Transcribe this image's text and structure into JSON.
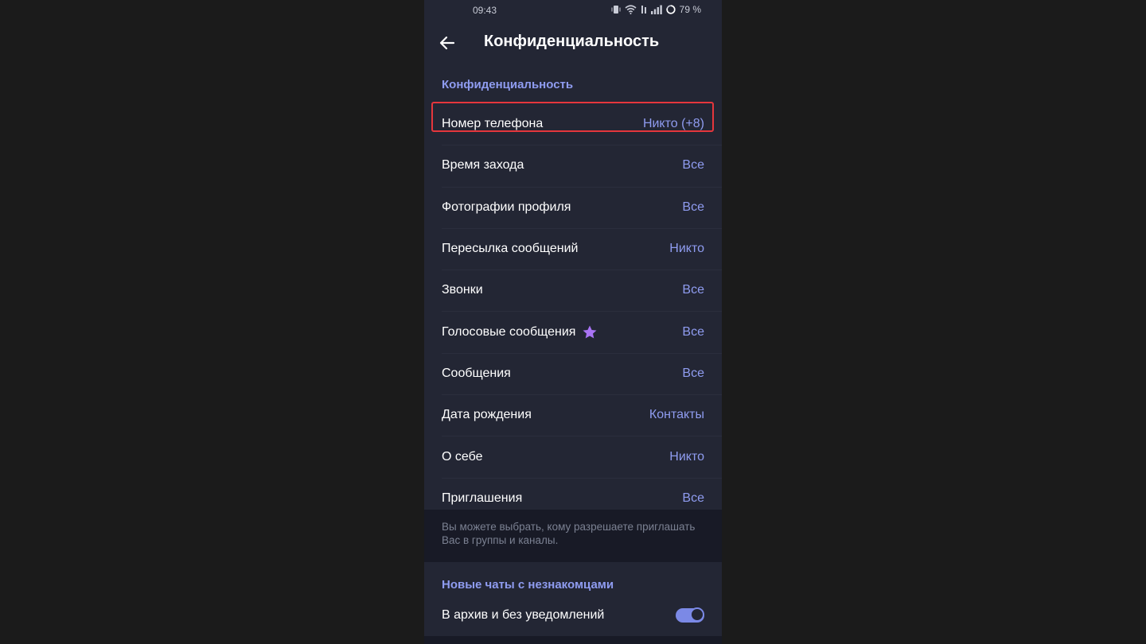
{
  "statusbar": {
    "time": "09:43",
    "battery": "79 %",
    "icons": [
      "vibrate-icon",
      "wifi-icon",
      "volte-icon",
      "signal-icon",
      "battery-icon"
    ]
  },
  "header": {
    "title": "Конфиденциальность",
    "back_icon": "arrow-left-icon"
  },
  "privacy": {
    "section_title": "Конфиденциальность",
    "items": [
      {
        "label": "Номер телефона",
        "value": "Никто (+8)"
      },
      {
        "label": "Время захода",
        "value": "Все"
      },
      {
        "label": "Фотографии профиля",
        "value": "Все"
      },
      {
        "label": "Пересылка сообщений",
        "value": "Никто"
      },
      {
        "label": "Звонки",
        "value": "Все"
      },
      {
        "label": "Голосовые сообщения",
        "value": "Все",
        "badge_icon": "premium-star-icon"
      },
      {
        "label": "Сообщения",
        "value": "Все"
      },
      {
        "label": "Дата рождения",
        "value": "Контакты"
      },
      {
        "label": "О себе",
        "value": "Никто"
      },
      {
        "label": "Приглашения",
        "value": "Все"
      }
    ],
    "footnote": "Вы можете выбрать, кому разрешаете приглашать Вас в группы и каналы."
  },
  "new_chats": {
    "section_title": "Новые чаты с незнакомцами",
    "toggle_label": "В архив и без уведомлений",
    "toggle_on": true
  },
  "colors": {
    "accent": "#8f9cf0",
    "highlight": "#e5363c",
    "star": "#a974f5",
    "background": "#232634"
  }
}
